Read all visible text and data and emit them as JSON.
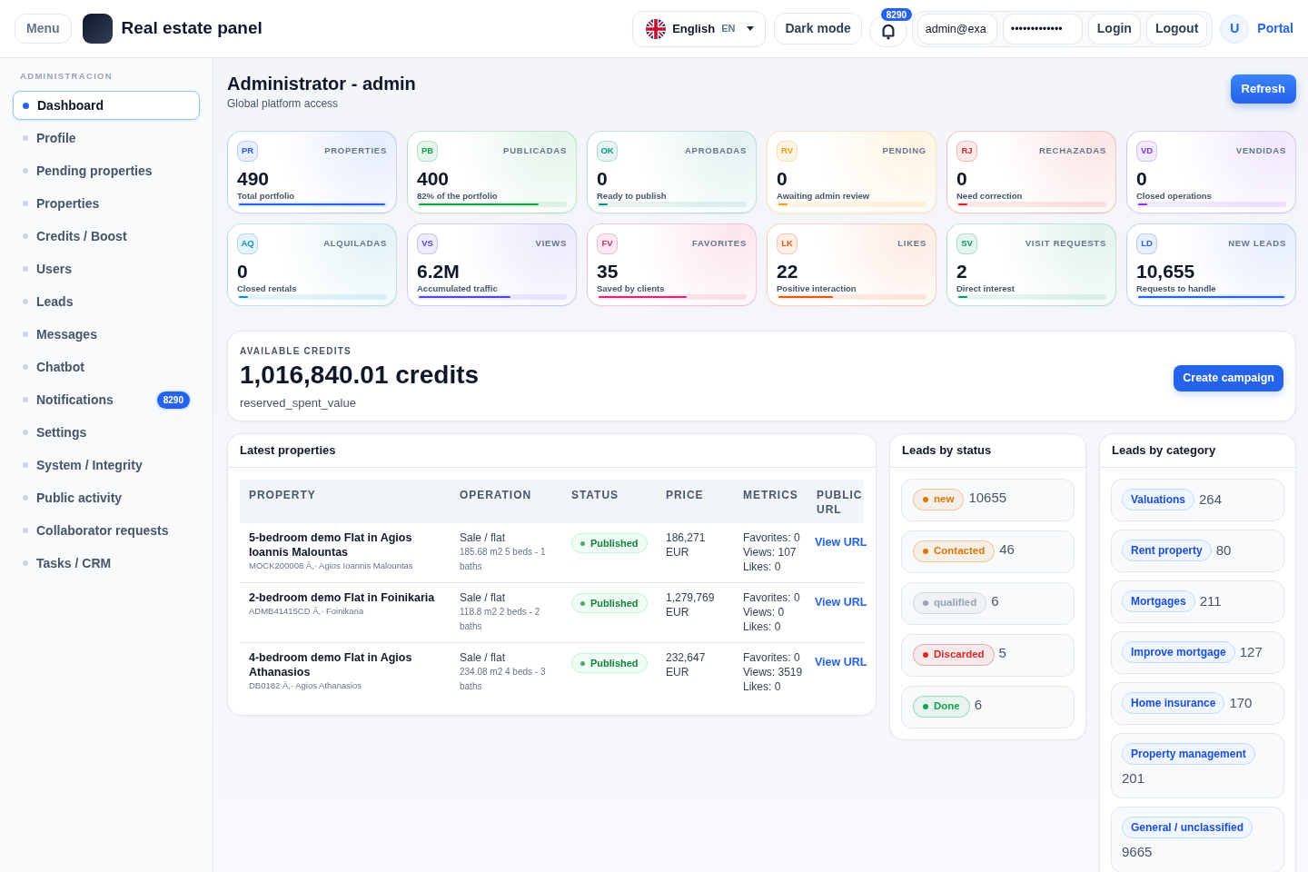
{
  "header": {
    "menu_button": "Menu",
    "title": "Real estate panel",
    "language": {
      "name": "English",
      "code": "EN"
    },
    "theme_button": "Dark mode",
    "notifications_count": "8290",
    "login": {
      "email": "admin@exa",
      "password": "•••••••••••••",
      "login_button": "Login",
      "logout_button": "Logout"
    },
    "avatar": "U",
    "portal_link": "Portal"
  },
  "sidebar": {
    "section": "ADMINISTRACION",
    "items": [
      {
        "label": "Dashboard",
        "selected": true
      },
      {
        "label": "Profile",
        "selected": false
      },
      {
        "label": "Pending properties",
        "selected": false
      },
      {
        "label": "Properties",
        "selected": false
      },
      {
        "label": "Credits / Boost",
        "selected": false
      },
      {
        "label": "Users",
        "selected": false
      },
      {
        "label": "Leads",
        "selected": false
      },
      {
        "label": "Messages",
        "selected": false
      },
      {
        "label": "Chatbot",
        "selected": false
      },
      {
        "label": "Notifications",
        "selected": false,
        "badge": "8290"
      },
      {
        "label": "Settings",
        "selected": false
      },
      {
        "label": "System / Integrity",
        "selected": false
      },
      {
        "label": "Public activity",
        "selected": false
      },
      {
        "label": "Collaborator requests",
        "selected": false
      },
      {
        "label": "Tasks / CRM",
        "selected": false
      }
    ]
  },
  "page": {
    "title": "Administrator - admin",
    "subtitle": "Global platform access",
    "refresh_button": "Refresh"
  },
  "stats": [
    {
      "code": "PR",
      "title": "PROPERTIES",
      "value": "490",
      "caption": "Total portfolio",
      "level": 1,
      "color": "#2563eb"
    },
    {
      "code": "PB",
      "title": "PUBLICADAS",
      "value": "400",
      "caption": "82% of the portfolio",
      "level": 0.82,
      "color": "#16a34a"
    },
    {
      "code": "OK",
      "title": "APROBADAS",
      "value": "0",
      "caption": "Ready to publish",
      "level": 0.06,
      "color": "#0d9488"
    },
    {
      "code": "RV",
      "title": "PENDING",
      "value": "0",
      "caption": "Awaiting admin review",
      "level": 0.06,
      "color": "#f59e0b"
    },
    {
      "code": "RJ",
      "title": "RECHAZADAS",
      "value": "0",
      "caption": "Need correction",
      "level": 0.06,
      "color": "#dc2626"
    },
    {
      "code": "VD",
      "title": "VENDIDAS",
      "value": "0",
      "caption": "Closed operations",
      "level": 0.06,
      "color": "#7c3aed"
    },
    {
      "code": "AQ",
      "title": "ALQUILADAS",
      "value": "0",
      "caption": "Closed rentals",
      "level": 0.06,
      "color": "#0891b2"
    },
    {
      "code": "VS",
      "title": "VIEWS",
      "value": "6.2M",
      "caption": "Accumulated traffic",
      "level": 0.63,
      "color": "#4f46e5"
    },
    {
      "code": "FV",
      "title": "FAVORITES",
      "value": "35",
      "caption": "Saved by clients",
      "level": 0.6,
      "color": "#db2777"
    },
    {
      "code": "LK",
      "title": "LIKES",
      "value": "22",
      "caption": "Positive interaction",
      "level": 0.37,
      "color": "#ea580c"
    },
    {
      "code": "SV",
      "title": "VISIT REQUESTS",
      "value": "2",
      "caption": "Direct interest",
      "level": 0.06,
      "color": "#059669"
    },
    {
      "code": "LD",
      "title": "NEW LEADS",
      "value": "10,655",
      "caption": "Requests to handle",
      "level": 1,
      "color": "#2563eb"
    }
  ],
  "credits": {
    "label": "AVAILABLE CREDITS",
    "amount": "1,016,840.01 credits",
    "note": "reserved_spent_value",
    "button": "Create campaign"
  },
  "latest_properties": {
    "title": "Latest properties",
    "columns": [
      "PROPERTY",
      "OPERATION",
      "STATUS",
      "PRICE",
      "METRICS",
      "PUBLIC URL"
    ],
    "rows": [
      {
        "name": "5-bedroom demo Flat in Agios Ioannis Malountas",
        "reference": "MOCK200008 Ã,· Agios Ioannis Malountas",
        "operation": "Sale / flat",
        "details": "185.68 m2 5 beds - 1 baths",
        "status": "Published",
        "price": "186,271 EUR",
        "metrics": [
          "Favorites: 0",
          "Views: 107",
          "Likes: 0"
        ],
        "link": "View URL"
      },
      {
        "name": "2-bedroom demo Flat in Foinikaria",
        "reference": "ADMB41415CD Ã,· Foinikaria",
        "operation": "Sale / flat",
        "details": "118.8 m2 2 beds - 2 baths",
        "status": "Published",
        "price": "1,279,769 EUR",
        "metrics": [
          "Favorites: 0",
          "Views: 0",
          "Likes: 0"
        ],
        "link": "View URL"
      },
      {
        "name": "4-bedroom demo Flat in Agios Athanasios",
        "reference": "DB0182 Ã,· Agios Athanasios",
        "operation": "Sale / flat",
        "details": "234.08 m2 4 beds - 3 baths",
        "status": "Published",
        "price": "232,647 EUR",
        "metrics": [
          "Favorites: 0",
          "Views: 3519",
          "Likes: 0"
        ],
        "link": "View URL"
      }
    ]
  },
  "leads_by_status": {
    "title": "Leads by status",
    "items": [
      {
        "label": "new",
        "count": "10655",
        "color": "#d97706"
      },
      {
        "label": "Contacted",
        "count": "46",
        "color": "#d97706"
      },
      {
        "label": "qualified",
        "count": "6",
        "color": "#94a3b8"
      },
      {
        "label": "Discarded",
        "count": "5",
        "color": "#dc2626"
      },
      {
        "label": "Done",
        "count": "6",
        "color": "#16a34a"
      }
    ]
  },
  "leads_by_category": {
    "title": "Leads by category",
    "items": [
      {
        "label": "Valuations",
        "count": "264"
      },
      {
        "label": "Rent property",
        "count": "80"
      },
      {
        "label": "Mortgages",
        "count": "211"
      },
      {
        "label": "Improve mortgage",
        "count": "127"
      },
      {
        "label": "Home insurance",
        "count": "170"
      },
      {
        "label": "Property management",
        "count": "201"
      },
      {
        "label": "General / unclassified",
        "count": "9665"
      }
    ]
  }
}
